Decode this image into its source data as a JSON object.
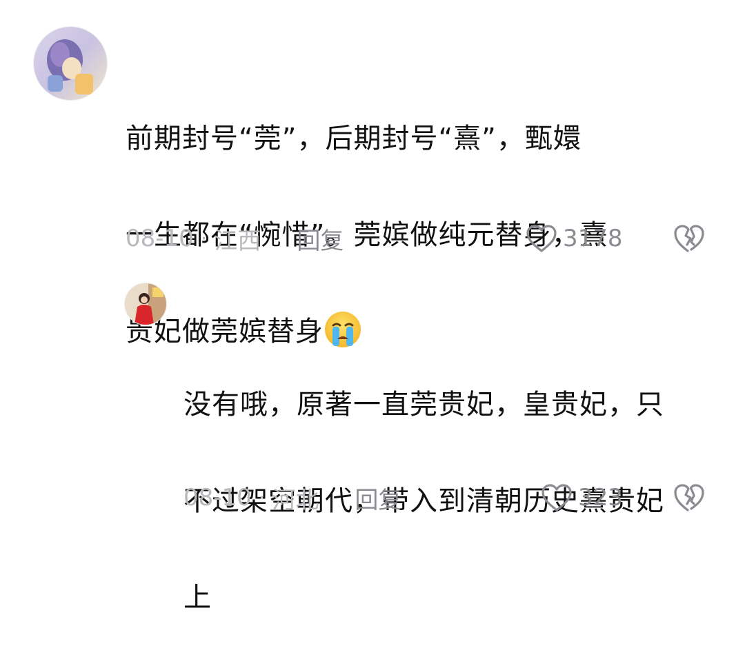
{
  "comment": {
    "text_line1": "前期封号“莞”，后期封号“熹”，甄嬛",
    "text_line2": "一生都在“惋惜”。莞嫔做纯元替身，熹",
    "text_line3": "贵妃做莞嫔替身",
    "emoji": "crying-face",
    "date": "08-10",
    "separator": "·",
    "location": "江西",
    "reply_label": "回复",
    "like_count": "3178"
  },
  "reply": {
    "text_line1": "没有哦，原著一直莞贵妃，皇贵妃，只",
    "text_line2": "不过架空朝代，带入到清朝历史熹贵妃",
    "text_line3": "上",
    "date": "08-10",
    "separator": "·",
    "location": "河北",
    "reply_label": "回复",
    "like_count": "323"
  },
  "colors": {
    "text": "#111111",
    "meta": "#b8b8bd",
    "action": "#8a8b91"
  }
}
